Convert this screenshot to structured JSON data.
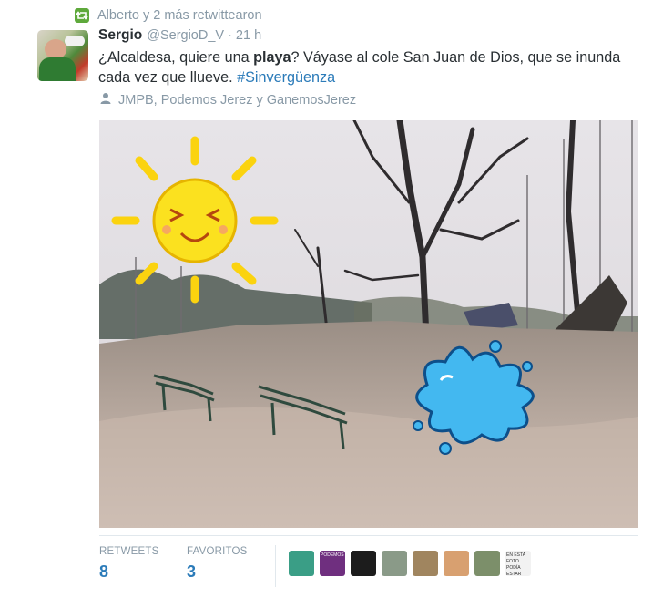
{
  "retweet_context": {
    "text": "Alberto y 2 más retwittearon",
    "icon": "retweet-icon"
  },
  "tweet": {
    "author_name": "Sergio",
    "author_handle": "@SergioD_V",
    "separator": "·",
    "time": "21 h",
    "text_part1": "¿Alcaldesa, quiere una ",
    "text_bold": "playa",
    "text_part2": "? Váyase al cole San Juan de Dios, que se inunda cada vez que llueve. ",
    "hashtag": "#Sinvergüenza",
    "tagged": {
      "icon": "person-icon",
      "text": "JMPB, Podemos Jerez y GanemosJerez"
    }
  },
  "stats": {
    "retweets_label": "RETWEETS",
    "retweets_value": "8",
    "favorites_label": "FAVORITOS",
    "favorites_value": "3"
  },
  "favoriters": [
    {
      "name": "faver-avatar-1",
      "color": "#3a9e86",
      "text": ""
    },
    {
      "name": "faver-avatar-2",
      "color": "#6f2f7f",
      "text": "PODEMOS"
    },
    {
      "name": "faver-avatar-3",
      "color": "#1c1c1c",
      "text": ""
    },
    {
      "name": "faver-avatar-4",
      "color": "#8a9a88",
      "text": ""
    },
    {
      "name": "faver-avatar-5",
      "color": "#a0855f",
      "text": ""
    },
    {
      "name": "faver-avatar-6",
      "color": "#d8a070",
      "text": ""
    },
    {
      "name": "faver-avatar-7",
      "color": "#7c8f6a",
      "text": ""
    },
    {
      "name": "faver-avatar-8",
      "color": "#f2f2f2",
      "text": "EN ESTA FOTO PODÍA ESTAR CUALQUIERA"
    }
  ],
  "colors": {
    "accent": "#2b7bb9",
    "retweet_green": "#5ea93b",
    "muted": "#8899a6"
  }
}
